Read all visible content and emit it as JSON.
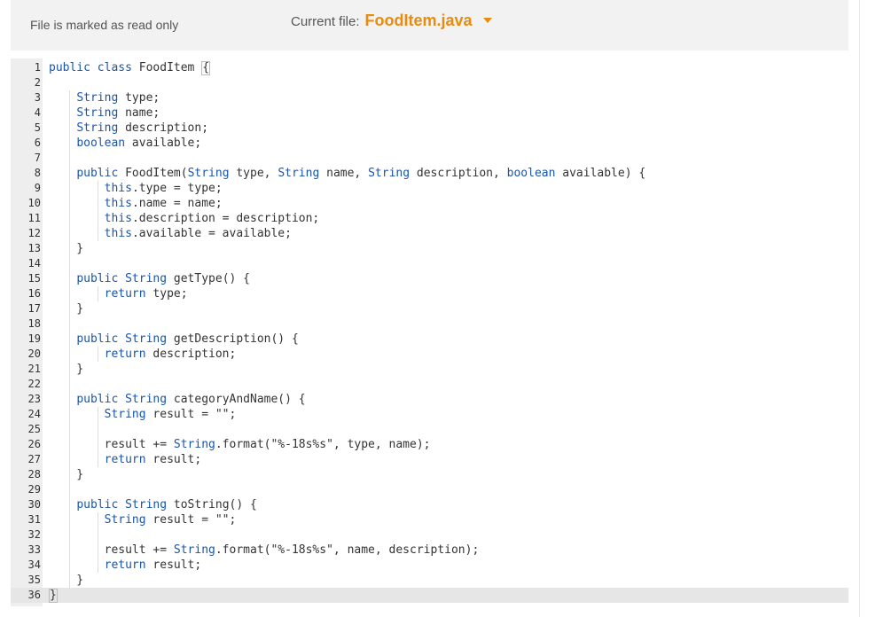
{
  "header": {
    "readonly_text": "File is marked as read only",
    "current_file_label": "Current file:",
    "current_file_name": "FoodItem.java"
  },
  "colors": {
    "accent": "#e98b0c",
    "keyword": "#1a55a8",
    "gutter": "#eeeeee",
    "header_bg": "#f2f2f2"
  },
  "editor": {
    "lines": [
      {
        "n": "1",
        "code": "public class FoodItem {"
      },
      {
        "n": "2",
        "code": ""
      },
      {
        "n": "3",
        "code": "    String type;"
      },
      {
        "n": "4",
        "code": "    String name;"
      },
      {
        "n": "5",
        "code": "    String description;"
      },
      {
        "n": "6",
        "code": "    boolean available;"
      },
      {
        "n": "7",
        "code": ""
      },
      {
        "n": "8",
        "code": "    public FoodItem(String type, String name, String description, boolean available) {"
      },
      {
        "n": "9",
        "code": "        this.type = type;"
      },
      {
        "n": "10",
        "code": "        this.name = name;"
      },
      {
        "n": "11",
        "code": "        this.description = description;"
      },
      {
        "n": "12",
        "code": "        this.available = available;"
      },
      {
        "n": "13",
        "code": "    }"
      },
      {
        "n": "14",
        "code": ""
      },
      {
        "n": "15",
        "code": "    public String getType() {"
      },
      {
        "n": "16",
        "code": "        return type;"
      },
      {
        "n": "17",
        "code": "    }"
      },
      {
        "n": "18",
        "code": ""
      },
      {
        "n": "19",
        "code": "    public String getDescription() {"
      },
      {
        "n": "20",
        "code": "        return description;"
      },
      {
        "n": "21",
        "code": "    }"
      },
      {
        "n": "22",
        "code": ""
      },
      {
        "n": "23",
        "code": "    public String categoryAndName() {"
      },
      {
        "n": "24",
        "code": "        String result = \"\";"
      },
      {
        "n": "25",
        "code": ""
      },
      {
        "n": "26",
        "code": "        result += String.format(\"%-18s%s\", type, name);"
      },
      {
        "n": "27",
        "code": "        return result;"
      },
      {
        "n": "28",
        "code": "    }"
      },
      {
        "n": "29",
        "code": ""
      },
      {
        "n": "30",
        "code": "    public String toString() {"
      },
      {
        "n": "31",
        "code": "        String result = \"\";"
      },
      {
        "n": "32",
        "code": ""
      },
      {
        "n": "33",
        "code": "        result += String.format(\"%-18s%s\", name, description);"
      },
      {
        "n": "34",
        "code": "        return result;"
      },
      {
        "n": "35",
        "code": "    }"
      },
      {
        "n": "36",
        "code": "}"
      }
    ]
  }
}
